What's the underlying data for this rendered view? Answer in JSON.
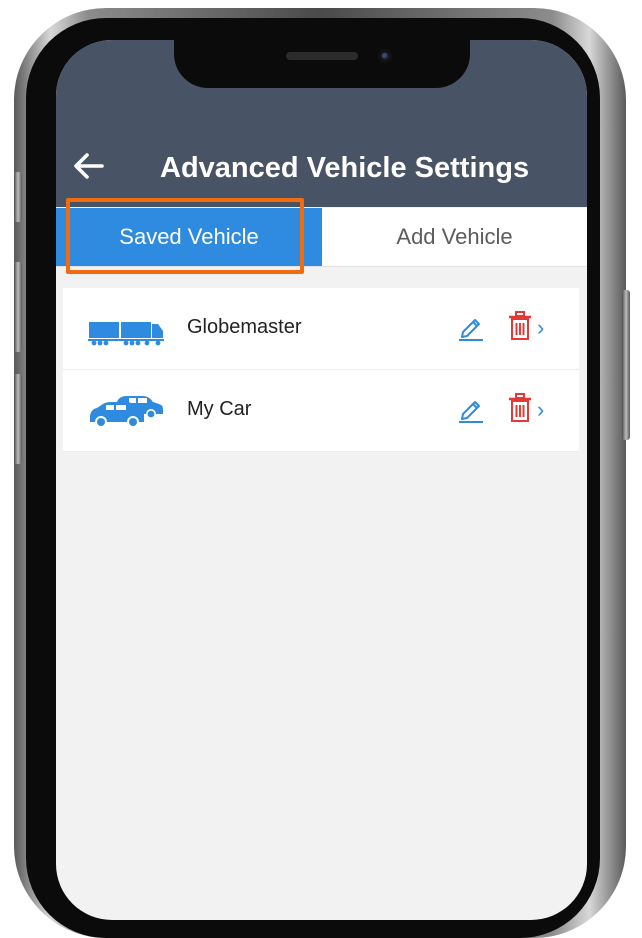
{
  "header": {
    "title": "Advanced Vehicle Settings",
    "back_icon": "arrow-left-icon"
  },
  "tabs": [
    {
      "label": "Saved Vehicle",
      "selected": true
    },
    {
      "label": "Add Vehicle",
      "selected": false
    }
  ],
  "vehicles": [
    {
      "name": "Globemaster",
      "icon": "truck-icon"
    },
    {
      "name": "My Car",
      "icon": "cars-icon"
    }
  ],
  "colors": {
    "header_bg": "#495366",
    "accent": "#2f8be0",
    "delete": "#e53935",
    "highlight": "#f26b10",
    "screen_bg": "#f2f2f2"
  },
  "icons": {
    "edit": "pencil-icon",
    "delete": "trash-icon",
    "chevron": "chevron-right-icon"
  }
}
